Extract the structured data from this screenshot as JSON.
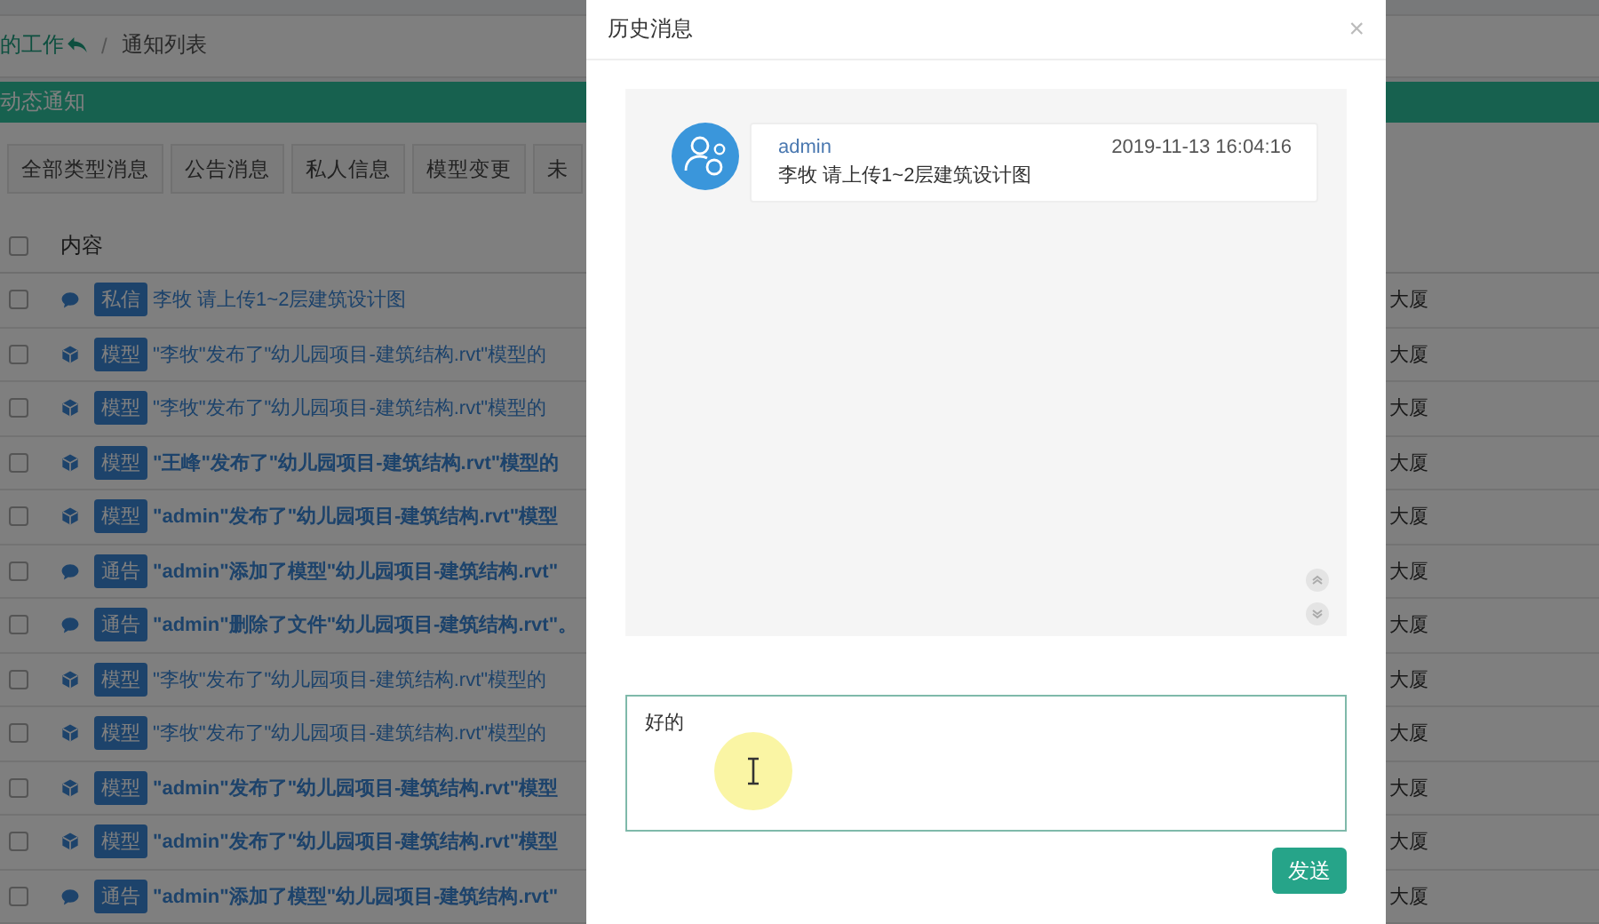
{
  "page": {
    "breadcrumb": {
      "items": [
        {
          "label": "的工作",
          "link": true
        },
        {
          "label": "通知列表",
          "link": false
        }
      ],
      "separator": "/"
    },
    "section_title": "动态通知",
    "filter_tabs": [
      {
        "label": "全部类型消息",
        "selected": false
      },
      {
        "label": "公告消息",
        "selected": false
      },
      {
        "label": "私人信息",
        "selected": false
      },
      {
        "label": "模型变更",
        "selected": false
      },
      {
        "label": "未",
        "selected": false
      }
    ],
    "table": {
      "header": {
        "checked": false,
        "content": "内容"
      },
      "rows": [
        {
          "kind": "chat",
          "tag": "私信",
          "text": "李牧 请上传1~2层建筑设计图",
          "unread": false,
          "checked": false,
          "column_3": "大厦"
        },
        {
          "kind": "model",
          "tag": "模型",
          "text": "\"李牧\"发布了\"幼儿园项目-建筑结构.rvt\"模型的",
          "unread": false,
          "checked": false,
          "column_3": "大厦"
        },
        {
          "kind": "model",
          "tag": "模型",
          "text": "\"李牧\"发布了\"幼儿园项目-建筑结构.rvt\"模型的",
          "unread": false,
          "checked": false,
          "column_3": "大厦"
        },
        {
          "kind": "model",
          "tag": "模型",
          "text": "\"王峰\"发布了\"幼儿园项目-建筑结构.rvt\"模型的",
          "unread": true,
          "checked": false,
          "column_3": "大厦"
        },
        {
          "kind": "model",
          "tag": "模型",
          "text": "\"admin\"发布了\"幼儿园项目-建筑结构.rvt\"模型",
          "unread": true,
          "checked": false,
          "column_3": "大厦"
        },
        {
          "kind": "chat",
          "tag": "通告",
          "text": "\"admin\"添加了模型\"幼儿园项目-建筑结构.rvt\"",
          "unread": true,
          "checked": false,
          "column_3": "大厦"
        },
        {
          "kind": "chat",
          "tag": "通告",
          "text": "\"admin\"删除了文件\"幼儿园项目-建筑结构.rvt\"。",
          "unread": true,
          "checked": false,
          "column_3": "大厦"
        },
        {
          "kind": "model",
          "tag": "模型",
          "text": "\"李牧\"发布了\"幼儿园项目-建筑结构.rvt\"模型的",
          "unread": false,
          "checked": false,
          "column_3": "大厦"
        },
        {
          "kind": "model",
          "tag": "模型",
          "text": "\"李牧\"发布了\"幼儿园项目-建筑结构.rvt\"模型的",
          "unread": false,
          "checked": false,
          "column_3": "大厦"
        },
        {
          "kind": "model",
          "tag": "模型",
          "text": "\"admin\"发布了\"幼儿园项目-建筑结构.rvt\"模型",
          "unread": true,
          "checked": false,
          "column_3": "大厦"
        },
        {
          "kind": "model",
          "tag": "模型",
          "text": "\"admin\"发布了\"幼儿园项目-建筑结构.rvt\"模型",
          "unread": true,
          "checked": false,
          "column_3": "大厦"
        },
        {
          "kind": "chat",
          "tag": "通告",
          "text": "\"admin\"添加了模型\"幼儿园项目-建筑结构.rvt\"",
          "unread": true,
          "checked": false,
          "column_3": "大厦"
        }
      ]
    }
  },
  "dialog": {
    "title": "历史消息",
    "close": "×",
    "messages": [
      {
        "sender": "admin",
        "time": "2019-11-13 16:04:16",
        "text": "李牧 请上传1~2层建筑设计图"
      }
    ],
    "reply": {
      "value": "好的"
    },
    "send_button": "发送"
  }
}
